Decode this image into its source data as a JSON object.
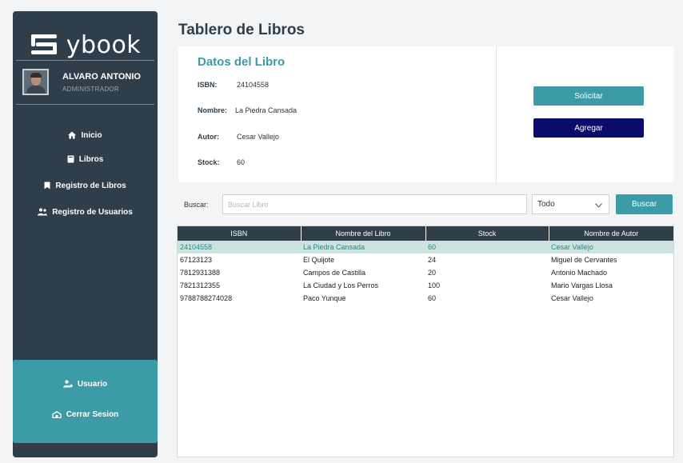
{
  "app": {
    "logo_text": "ybook"
  },
  "user": {
    "name": "ALVARO ANTONIO",
    "role": "ADMINISTRADOR"
  },
  "nav": {
    "items": [
      {
        "label": "Inicio",
        "icon": "home-icon"
      },
      {
        "label": "Libros",
        "icon": "book-icon"
      },
      {
        "label": "Registro de Libros",
        "icon": "bookmark-icon"
      },
      {
        "label": "Registro de Usuarios",
        "icon": "users-icon"
      }
    ],
    "bottom": [
      {
        "label": "Usuario",
        "icon": "user-cog-icon"
      },
      {
        "label": "Cerrar Sesion",
        "icon": "logout-icon"
      }
    ]
  },
  "page": {
    "title": "Tablero de Libros"
  },
  "book": {
    "section_title": "Datos del Libro",
    "isbn_label": "ISBN:",
    "isbn": "24104558",
    "nombre_label": "Nombre:",
    "nombre": "La Piedra Cansada",
    "autor_label": "Autor:",
    "autor": "Cesar Vallejo",
    "stock_label": "Stock:",
    "stock": "60"
  },
  "actions": {
    "solicitar": "Solicitar",
    "agregar": "Agregar"
  },
  "search": {
    "label": "Buscar:",
    "placeholder": "Buscar Libro",
    "filter": "Todo",
    "button": "Buscar"
  },
  "table": {
    "headers": [
      "ISBN",
      "Nombre del Libro",
      "Stock",
      "Nombre de Autor"
    ],
    "rows": [
      [
        "24104558",
        "La Piedra Cansada",
        "60",
        "Cesar Vallejo"
      ],
      [
        "67123123",
        "El Quijote",
        "24",
        "Miguel de Cervantes"
      ],
      [
        "7812931388",
        "Campos de Castilla",
        "20",
        "Antonio Machado"
      ],
      [
        "7821312355",
        "La Ciudad y Los Perros",
        "100",
        "Mario Vargas Llosa"
      ],
      [
        "9788788274028",
        "Paco Yunque",
        "60",
        "Cesar Vallejo"
      ]
    ]
  },
  "colors": {
    "sidebar": "#2e3e4b",
    "accent": "#3b9ca7",
    "agregar": "#0b0b6b",
    "selected_row": "#cde3df"
  }
}
